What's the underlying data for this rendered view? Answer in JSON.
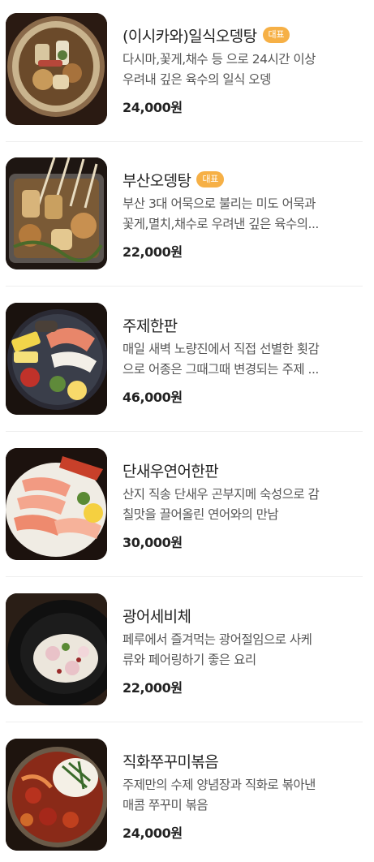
{
  "colors": {
    "badge_bg": "#f6b046",
    "text_main": "#222222",
    "text_desc": "#555555",
    "divider": "#eeeeee"
  },
  "menu": {
    "items": [
      {
        "name": "(이시카와)일식오뎅탕",
        "badge": "대표",
        "desc_line1": "다시마,꽃게,채수 등 으로 24시간 이상",
        "desc_line2": "우려내 깊은 육수의 일식 오뎅",
        "price": "24,000원",
        "image_icon": "oden-bowl-photo"
      },
      {
        "name": "부산오뎅탕",
        "badge": "대표",
        "desc_line1": "부산 3대 어묵으로 불리는 미도 어묵과",
        "desc_line2": "꽃게,멸치,채수로 우려낸 깊은 육수의...",
        "price": "22,000원",
        "image_icon": "busan-oden-skewers-photo"
      },
      {
        "name": "주제한판",
        "badge": "",
        "desc_line1": "매일 새벽 노량진에서 직접 선별한 횟감",
        "desc_line2": "으로 어종은 그때그때 변경되는 주제 ...",
        "price": "46,000원",
        "image_icon": "sashimi-platter-photo"
      },
      {
        "name": "단새우연어한판",
        "badge": "",
        "desc_line1": "산지 직송 단새우 곤부지메 숙성으로 감",
        "desc_line2": "칠맛을 끌어올린 연어와의 만남",
        "price": "30,000원",
        "image_icon": "shrimp-salmon-platter-photo"
      },
      {
        "name": "광어세비체",
        "badge": "",
        "desc_line1": "페루에서 즐겨먹는 광어절임으로 사케",
        "desc_line2": "류와 페어링하기 좋은 요리",
        "price": "22,000원",
        "image_icon": "flatfish-ceviche-photo"
      },
      {
        "name": "직화쭈꾸미볶음",
        "badge": "",
        "desc_line1": "주제만의 수제 양념장과 직화로 볶아낸",
        "desc_line2": "매콤 쭈꾸미 볶음",
        "price": "24,000원",
        "image_icon": "spicy-webfoot-octopus-photo"
      }
    ]
  }
}
